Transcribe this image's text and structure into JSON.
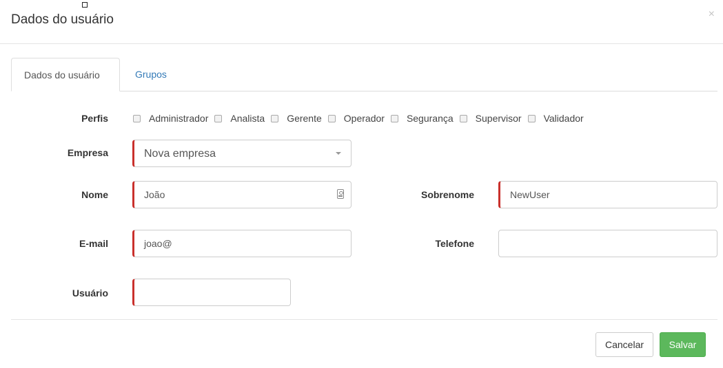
{
  "modal": {
    "title": "Dados do usuário",
    "close_label": "×"
  },
  "tabs": [
    {
      "label": "Dados do usuário",
      "active": true
    },
    {
      "label": "Grupos",
      "active": false
    }
  ],
  "form": {
    "perfis_label": "Perfis",
    "profiles": [
      "Administrador",
      "Analista",
      "Gerente",
      "Operador",
      "Segurança",
      "Supervisor",
      "Validador"
    ],
    "empresa_label": "Empresa",
    "empresa_value": "Nova empresa",
    "nome_label": "Nome",
    "nome_value": "João",
    "sobrenome_label": "Sobrenome",
    "sobrenome_value": "NewUser",
    "email_label": "E-mail",
    "email_value": "joao@",
    "telefone_label": "Telefone",
    "telefone_value": "",
    "usuario_label": "Usuário",
    "usuario_value": ""
  },
  "footer": {
    "cancel_label": "Cancelar",
    "save_label": "Salvar"
  },
  "colors": {
    "required_accent": "#c9302c",
    "save_button": "#5cb85c",
    "link": "#337ab7"
  }
}
